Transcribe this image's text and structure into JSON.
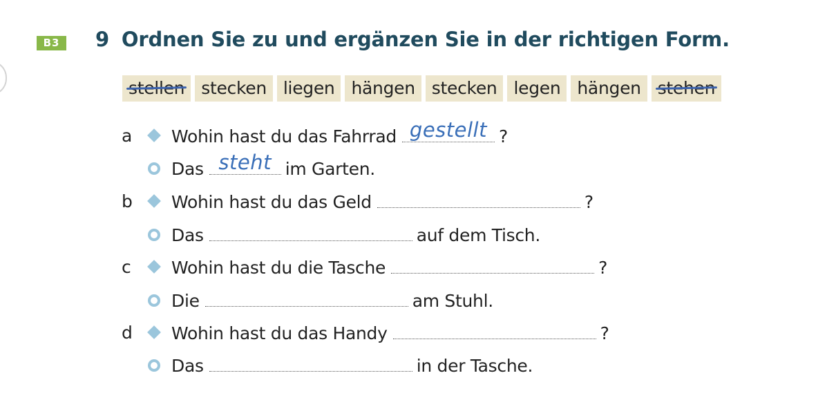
{
  "exercise": {
    "badge": "B3",
    "number": "9",
    "title": "Ordnen Sie zu und ergänzen Sie in der richtigen Form."
  },
  "word_box": [
    {
      "text": "stellen",
      "crossed_out": true
    },
    {
      "text": "stecken",
      "crossed_out": false
    },
    {
      "text": "liegen",
      "crossed_out": false
    },
    {
      "text": "hängen",
      "crossed_out": false
    },
    {
      "text": "stecken",
      "crossed_out": false
    },
    {
      "text": "legen",
      "crossed_out": false
    },
    {
      "text": "hängen",
      "crossed_out": false
    },
    {
      "text": "stehen",
      "crossed_out": true
    }
  ],
  "items": [
    {
      "letter": "a",
      "question": {
        "before": "Wohin hast du das Fahrrad",
        "answer": "gestellt",
        "after": "?"
      },
      "response": {
        "before": "Das",
        "answer": "steht",
        "after": "im Garten."
      }
    },
    {
      "letter": "b",
      "question": {
        "before": "Wohin hast du das Geld",
        "answer": "",
        "after": "?"
      },
      "response": {
        "before": "Das",
        "answer": "",
        "after": "auf dem Tisch."
      }
    },
    {
      "letter": "c",
      "question": {
        "before": "Wohin hast du die Tasche",
        "answer": "",
        "after": "?"
      },
      "response": {
        "before": "Die",
        "answer": "",
        "after": "am Stuhl."
      }
    },
    {
      "letter": "d",
      "question": {
        "before": "Wohin hast du das Handy",
        "answer": "",
        "after": "?"
      },
      "response": {
        "before": "Das",
        "answer": "",
        "after": "in der Tasche."
      }
    }
  ],
  "icons": {
    "question_marker": "diamond-icon",
    "response_marker": "ring-icon"
  },
  "colors": {
    "title": "#204b5e",
    "badge": "#89b849",
    "word_box_bg": "#ede6cd",
    "marker": "#9bc6dc",
    "handwriting": "#3a6fb8",
    "strike": "#3b62ad"
  }
}
